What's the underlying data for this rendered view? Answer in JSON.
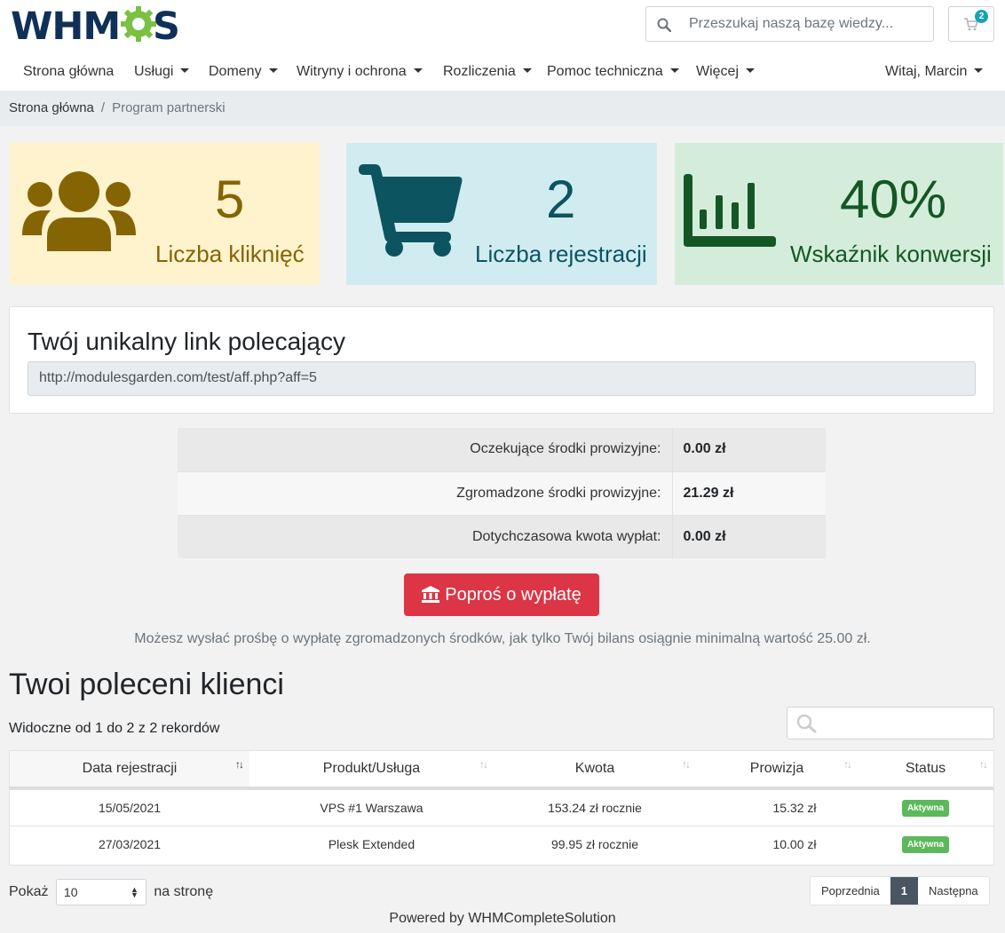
{
  "header": {
    "logo_text": "WHMCS",
    "search_placeholder": "Przeszukaj naszą bazę wiedzy...",
    "cart_count": "2"
  },
  "nav": {
    "items": [
      "Strona główna",
      "Usługi",
      "Domeny",
      "Witryny i ochrona",
      "Rozliczenia",
      "Pomoc techniczna",
      "Więcej"
    ],
    "user": "Witaj, Marcin"
  },
  "breadcrumb": {
    "home": "Strona główna",
    "current": "Program partnerski"
  },
  "stats": [
    {
      "value": "5",
      "label": "Liczba kliknięć",
      "icon": "users-icon",
      "color": "#856404"
    },
    {
      "value": "2",
      "label": "Liczba rejestracji",
      "icon": "shopping-cart-icon",
      "color": "#0c5460"
    },
    {
      "value": "40%",
      "label": "Wskaźnik konwersji",
      "icon": "chart-bar-icon",
      "color": "#155724"
    }
  ],
  "referral": {
    "title": "Twój unikalny link polecający",
    "link": "http://modulesgarden.com/test/aff.php?aff=5"
  },
  "commissions": [
    {
      "label": "Oczekujące środki prowizyjne:",
      "value": "0.00 zł"
    },
    {
      "label": "Zgromadzone środki prowizyjne:",
      "value": "21.29 zł"
    },
    {
      "label": "Dotychczasowa kwota wypłat:",
      "value": "0.00 zł"
    }
  ],
  "payout": {
    "button": "Poproś o wypłatę",
    "note": "Możesz wysłać prośbę o wypłatę zgromadzonych środków, jak tylko Twój bilans osiągnie minimalną wartość 25.00 zł."
  },
  "referrals": {
    "title": "Twoi poleceni klienci",
    "info": "Widoczne od 1 do 2 z 2 rekordów",
    "columns": [
      "Data rejestracji",
      "Produkt/Usługa",
      "Kwota",
      "Prowizja",
      "Status"
    ],
    "rows": [
      [
        "15/05/2021",
        "VPS #1 Warszawa",
        "153.24 zł rocznie",
        "15.32 zł",
        "Aktywna"
      ],
      [
        "27/03/2021",
        "Plesk Extended",
        "99.95 zł rocznie",
        "10.00 zł",
        "Aktywna"
      ]
    ],
    "show_label": "Pokaż",
    "per_page": "10",
    "per_page_suffix": "na stronę",
    "prev": "Poprzednia",
    "page": "1",
    "next": "Następna"
  },
  "footer": "Powered by WHMCompleteSolution"
}
